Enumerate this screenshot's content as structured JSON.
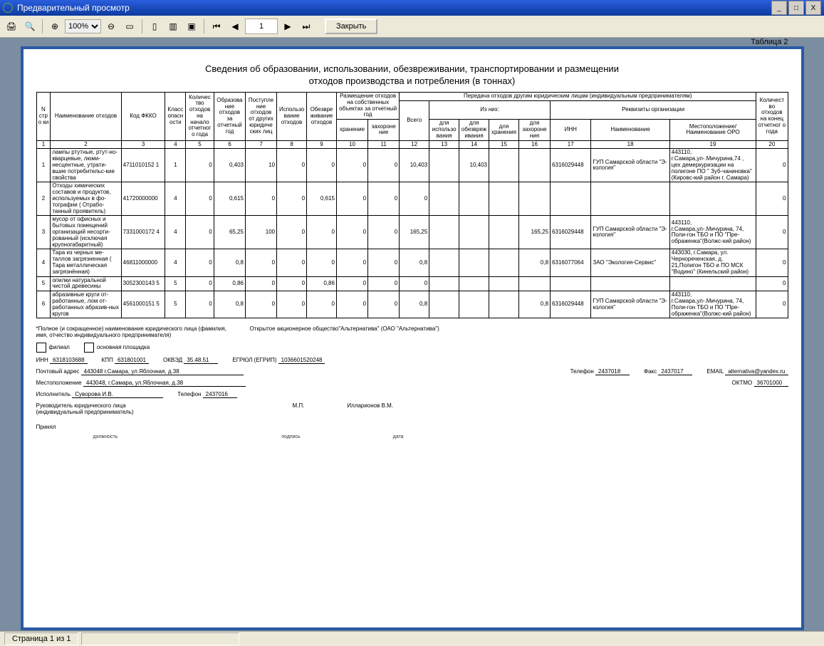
{
  "window": {
    "title": "Предварительный просмотр",
    "min": "_",
    "max": "□",
    "close": "X"
  },
  "toolbar": {
    "zoom": "100%",
    "page_value": "1",
    "close_label": "Закрыть"
  },
  "doc": {
    "title1": "Сведения об образовании, использовании, обезвреживании, транспортировании и размещении",
    "title2": "отходов производства и потребления (в тоннах)",
    "table_label": "Таблица 2",
    "header": {
      "c1": "N стро ки",
      "c2": "Наименование отходов",
      "c3": "Код ФККО",
      "c4": "Класс опасн ости",
      "c5": "Количес тво отходов на начало отчетног о года",
      "c6": "Образова ние отходов за отчетный год",
      "c7": "Поступле ние отходов от других юридиче ских лиц",
      "c8": "Использо вание отходов",
      "c9": "Обезвре живание отходов",
      "g10": "Размещение отходов на собственных объектах за отчетный год",
      "c10": "хранение",
      "c11": "захороне ние",
      "g12": "Передача отходов другим юридическим лицам (индивидуальным предпринимателям)",
      "g12a": "Из них:",
      "g12b": "Реквизиты организации",
      "c12": "Всего",
      "c13": "для использо вания",
      "c14": "для обезвреж ивания",
      "c15": "для хранения",
      "c16": "для захороне ния",
      "c17": "ИНН",
      "c18": "Наименование",
      "c19": "Местоположение/ Наименование ОРО",
      "c20": "Количест во отходов на конец отчетног о года"
    },
    "colnums": [
      "1",
      "2",
      "3",
      "4",
      "5",
      "6",
      "7",
      "8",
      "9",
      "10",
      "11",
      "12",
      "13",
      "14",
      "15",
      "16",
      "17",
      "18",
      "19",
      "20"
    ],
    "rows": [
      {
        "n": "1",
        "name": "лампы ртутные, ртут-но-кварцевые, люми-несцентные, утрати-вшие потребительс-кие свойства",
        "code": "4711010152 1",
        "kl": "1",
        "nstart": "0",
        "form": "0,403",
        "in": "10",
        "use": "0",
        "neut": "0",
        "stor": "0",
        "bur": "0",
        "all": "10,403",
        "tuse": "",
        "tneut": "10,403",
        "tstor": "",
        "tbur": "",
        "inn": "6316029448",
        "org": "ГУП Самарской области \"Э-кология\"",
        "loc": "443110, г.Самара,ул-.Мичурина,74 , цех демеркуризации на полигоне ПО \" Зуб-чаниновка\" (Кировс-кий район г. Самара)",
        "end": "0"
      },
      {
        "n": "2",
        "name": "Отходы химических составов и продуктов, используемых в фо-тографии ( Отрабо-танный проявитель)",
        "code": "41720000000",
        "kl": "4",
        "nstart": "0",
        "form": "0,615",
        "in": "0",
        "use": "0",
        "neut": "0,615",
        "stor": "0",
        "bur": "0",
        "all": "0",
        "tuse": "",
        "tneut": "",
        "tstor": "",
        "tbur": "",
        "inn": "",
        "org": "",
        "loc": "",
        "end": "0"
      },
      {
        "n": "3",
        "name": "мусор от офисных и бытовых помещений организаций несорти-рованный (исключая крупногабаритный)",
        "code": "7331000172 4",
        "kl": "4",
        "nstart": "0",
        "form": "65,25",
        "in": "100",
        "use": "0",
        "neut": "0",
        "stor": "0",
        "bur": "0",
        "all": "165,25",
        "tuse": "",
        "tneut": "",
        "tstor": "",
        "tbur": "165,25",
        "inn": "6316029448",
        "org": "ГУП Самарской области \"Э-кология\"",
        "loc": "443110, г.Самара,ул-.Мичурина, 74, Поли-гон ТБО и ПО \"Пре-ображенка\"(Волжс-кий район)",
        "end": "0"
      },
      {
        "n": "4",
        "name": "Тара из черных ме-таллов загрязненная ( Тара металлическая загрязнённая)",
        "code": "46811000000",
        "kl": "4",
        "nstart": "0",
        "form": "0,8",
        "in": "0",
        "use": "0",
        "neut": "0",
        "stor": "0",
        "bur": "0",
        "all": "0,8",
        "tuse": "",
        "tneut": "",
        "tstor": "",
        "tbur": "0,8",
        "inn": "6316077064",
        "org": "ЗАО \"Экология-Сервис\"",
        "loc": "443030, г.Самара, ул. Чернореченская, д. 21,Полигон ТБО и ПО МСК \"Водино\" (Кинельский район)",
        "end": "0"
      },
      {
        "n": "5",
        "name": "опилки натуральной чистой древесины",
        "code": "3052300143 5",
        "kl": "5",
        "nstart": "0",
        "form": "0,86",
        "in": "0",
        "use": "0",
        "neut": "0,86",
        "stor": "0",
        "bur": "0",
        "all": "0",
        "tuse": "",
        "tneut": "",
        "tstor": "",
        "tbur": "",
        "inn": "",
        "org": "",
        "loc": "",
        "end": "0"
      },
      {
        "n": "6",
        "name": "абразивные круги от-работанные, лом от-работанных абразив-ных кругов",
        "code": "4561000151 5",
        "kl": "5",
        "nstart": "0",
        "form": "0,8",
        "in": "0",
        "use": "0",
        "neut": "0",
        "stor": "0",
        "bur": "0",
        "all": "0,8",
        "tuse": "",
        "tneut": "",
        "tstor": "",
        "tbur": "0,8",
        "inn": "6316029448",
        "org": "ГУП Самарской области \"Э-кология\"",
        "loc": "443110, г.Самара,ул-.Мичурина, 74, Поли-гон ТБО и ПО \"Пре-ображенка\"(Волжс-кий район)",
        "end": "0"
      }
    ],
    "foot": {
      "note1": "*Полное (и сокращенное) наименование юридического лица (фамилия, имя, отчество индивидуального предпринимателя)",
      "filial": "филиал",
      "osnpl": "основная площадка",
      "orgfull": "Открытое акционерное общество\"Альтернатива\" (ОАО \"Альтернатива\")",
      "inn_l": "ИНН",
      "inn_v": "6318103688",
      "kpp_l": "КПП",
      "kpp_v": "631801001",
      "okved_l": "ОКВЭД",
      "okved_v": "35.48.51",
      "egr_l": "ЕГРЮЛ (ЕГРИП)",
      "egr_v": "1036601520248",
      "addr_l": "Почтовый адрес",
      "addr_v": "443048    г.Самара, ул.Яблочная, д.38",
      "tel_l": "Телефон",
      "tel_v": "2437018",
      "fax_l": "Факс",
      "fax_v": "2437017",
      "email_l": "EMAIL",
      "email_v": "alternativa@yandex.ru",
      "loc_l": "Местоположение",
      "loc_v": "443048, г.Самара, ул.Яблочная, д.38",
      "oktmo_l": "ОКТМО",
      "oktmo_v": "36701000",
      "isp_l": "Исполнитель",
      "isp_v": "Суворова И.В.",
      "isp_tel_l": "Телефон",
      "isp_tel_v": "2437016",
      "ruk_l": "Руководитель юридического лица (индивидуальный предприниматель)",
      "ruk_v": "Илларионов В.М.",
      "mp": "М.П.",
      "prin": "Принял",
      "dol": "должность",
      "podp": "подпись",
      "data": "дата"
    }
  },
  "status": {
    "page": "Страница 1 из 1"
  }
}
